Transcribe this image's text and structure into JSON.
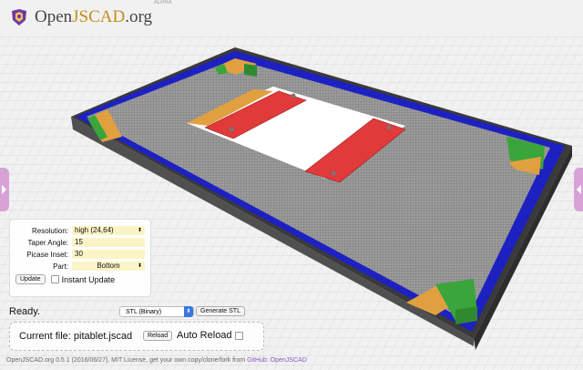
{
  "app": {
    "logo_text_pre": "Open",
    "logo_text_accent": "JSCAD",
    "logo_text_post": ".org",
    "logo_tag": "ALPHA"
  },
  "parameters": {
    "rows": [
      {
        "label": "Resolution:",
        "value": "high (24,64)",
        "kind": "select"
      },
      {
        "label": "Taper Angle:",
        "value": "15",
        "kind": "input"
      },
      {
        "label": "Picase Inset:",
        "value": "30",
        "kind": "input"
      },
      {
        "label": "Part:",
        "value": "Bottom",
        "kind": "select"
      }
    ],
    "update_label": "Update",
    "instant_update_label": "Instant Update"
  },
  "status": {
    "text": "Ready."
  },
  "export": {
    "format_value": "STL (Binary)",
    "generate_label": "Generate STL"
  },
  "file": {
    "current_label": "Current file: pitablet.jscad",
    "reload_label": "Reload",
    "auto_reload_label": "Auto Reload"
  },
  "footer": {
    "text": "OpenJSCAD.org 0.5.1 (2016/06/27), MIT License, get your own copy/clone/fork from ",
    "link": "GitHub: OpenJSCAD"
  },
  "colors": {
    "accent": "#c68c1b",
    "tab": "#d7a3d7",
    "rail": "#1d21c2",
    "red_bar": "#e03a3a",
    "green": "#3aa53a"
  }
}
